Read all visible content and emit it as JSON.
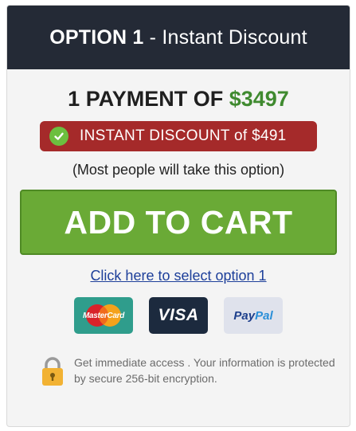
{
  "header": {
    "option": "OPTION 1",
    "separator": " - ",
    "subtitle": "Instant Discount"
  },
  "price": {
    "prefix": "1 PAYMENT OF ",
    "amount": "$3497"
  },
  "discount": {
    "label": "INSTANT DISCOUNT of $491"
  },
  "note": "(Most people will take this option)",
  "cta": {
    "label": "ADD TO CART"
  },
  "select_link": "Click here to select option 1",
  "payments": [
    {
      "name": "mastercard",
      "label": "MasterCard"
    },
    {
      "name": "visa",
      "label": "VISA"
    },
    {
      "name": "paypal",
      "label_part1": "Pay",
      "label_part2": "Pal"
    }
  ],
  "security": {
    "text": "Get immediate access . Your information is protected by secure 256-bit encryption."
  },
  "colors": {
    "header_bg": "#242a36",
    "price_green": "#3f8a2f",
    "discount_red": "#a52a2a",
    "cta_green": "#6aaa36",
    "link_blue": "#1d3f9a",
    "lock_gold": "#f2b233"
  },
  "icons": {
    "check": "check-circle-icon",
    "lock": "padlock-icon"
  }
}
